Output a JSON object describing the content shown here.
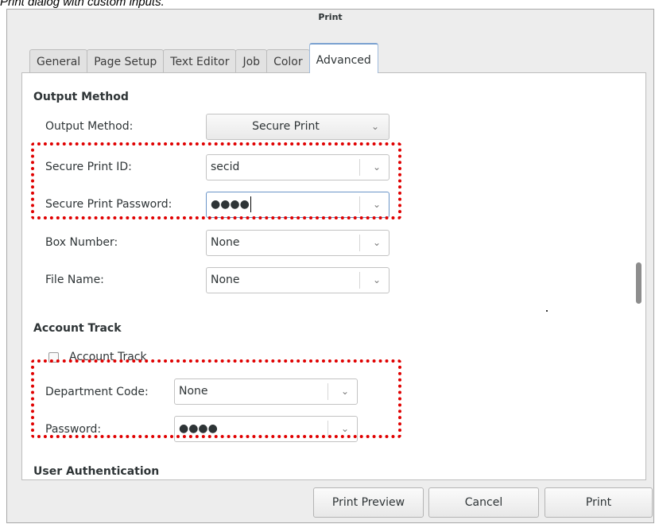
{
  "caption": "Print dialog with custom inputs.",
  "dialog": {
    "title": "Print"
  },
  "tabs": [
    {
      "label": "General"
    },
    {
      "label": "Page Setup"
    },
    {
      "label": "Text Editor"
    },
    {
      "label": "Job"
    },
    {
      "label": "Color"
    },
    {
      "label": "Advanced",
      "active": true
    }
  ],
  "output_method": {
    "heading": "Output Method",
    "method_label": "Output Method:",
    "method_value": "Secure Print",
    "secure_id_label": "Secure Print ID:",
    "secure_id_value": "secid",
    "secure_password_label": "Secure Print Password:",
    "secure_password_value": "●●●●",
    "box_number_label": "Box Number:",
    "box_number_value": "None",
    "file_name_label": "File Name:",
    "file_name_value": "None"
  },
  "account_track": {
    "heading": "Account Track",
    "checkbox_label": "Account Track",
    "checked": false,
    "department_label": "Department Code:",
    "department_value": "None",
    "password_label": "Password:",
    "password_value": "●●●●"
  },
  "user_auth": {
    "heading": "User Authentication"
  },
  "footer": {
    "preview_label": "Print Preview",
    "cancel_label": "Cancel",
    "print_label": "Print"
  },
  "colors": {
    "highlight": "#e00000",
    "accent": "#7aa1d0"
  }
}
